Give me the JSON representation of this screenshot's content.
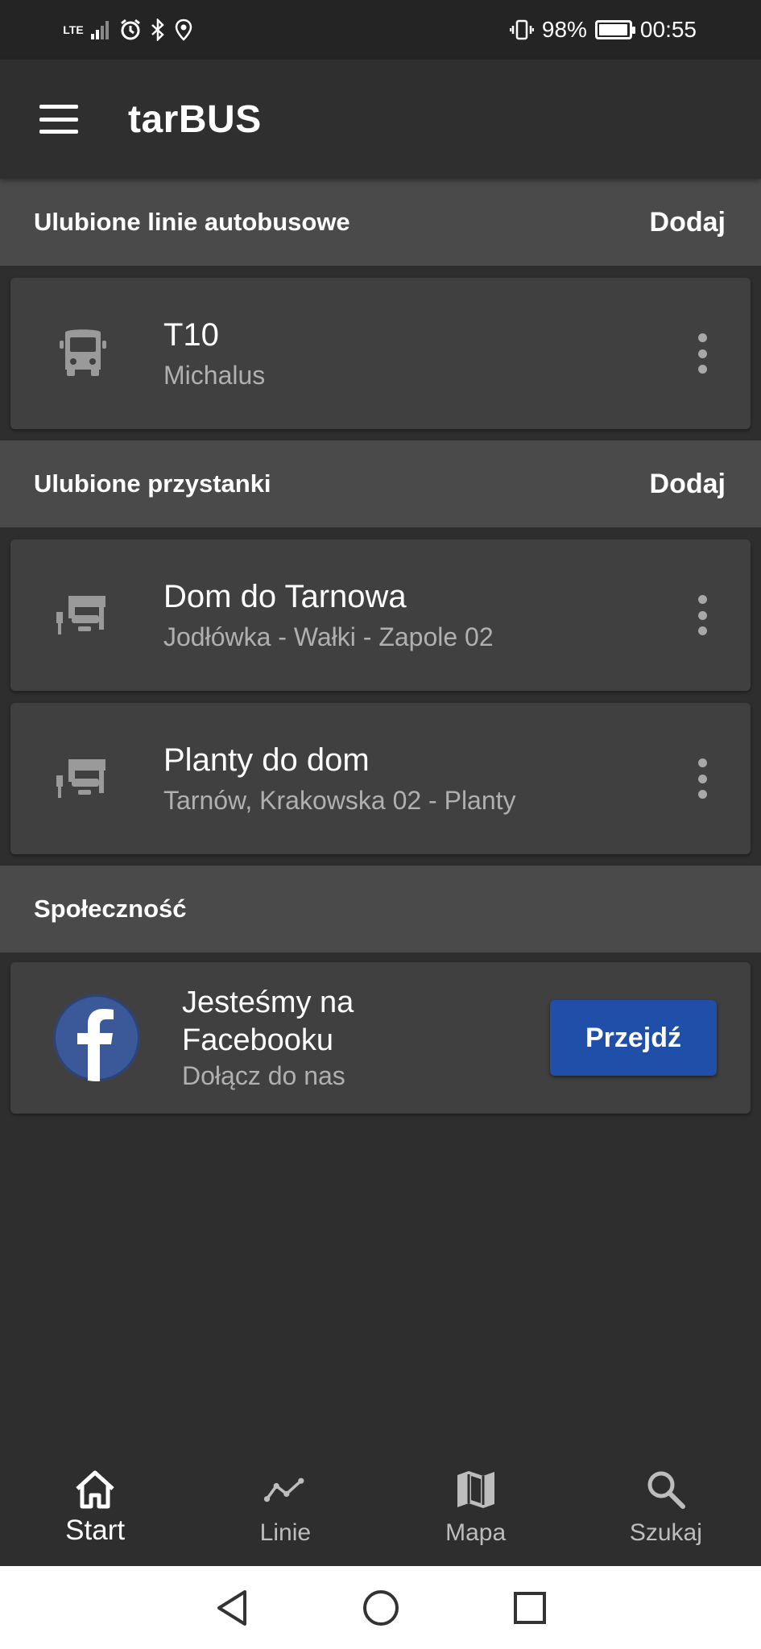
{
  "status_bar": {
    "network": "LTE",
    "battery": "98%",
    "time": "00:55",
    "battery_level": 0.98
  },
  "app_bar": {
    "title": "tarBUS",
    "menu_icon": "hamburger-menu-icon"
  },
  "favorite_lines": {
    "title": "Ulubione linie autobusowe",
    "action": "Dodaj",
    "items": [
      {
        "title": "T10",
        "subtitle": "Michalus",
        "icon": "bus-icon"
      }
    ]
  },
  "favorite_stops": {
    "title": "Ulubione przystanki",
    "action": "Dodaj",
    "items": [
      {
        "title": "Dom do Tarnowa",
        "subtitle": "Jodłówka - Wałki - Zapole 02",
        "icon": "bus-stop-icon"
      },
      {
        "title": "Planty do dom",
        "subtitle": "Tarnów, Krakowska 02 - Planty",
        "icon": "bus-stop-icon"
      }
    ]
  },
  "community": {
    "title": "Społeczność",
    "card": {
      "title": "Jesteśmy na Facebooku",
      "subtitle": "Dołącz do nas",
      "button": "Przejdź",
      "button_color": "#1f4fa8",
      "icon": "facebook-logo-icon"
    }
  },
  "bottom_nav": {
    "items": [
      {
        "label": "Start",
        "icon": "home-icon",
        "active": true
      },
      {
        "label": "Linie",
        "icon": "line-chart-icon",
        "active": false
      },
      {
        "label": "Mapa",
        "icon": "map-icon",
        "active": false
      },
      {
        "label": "Szukaj",
        "icon": "search-icon",
        "active": false
      }
    ]
  },
  "colors": {
    "background": "#2e2e2e",
    "section_header": "#4a4a4a",
    "card": "#404040",
    "accent": "#1f4fa8"
  }
}
